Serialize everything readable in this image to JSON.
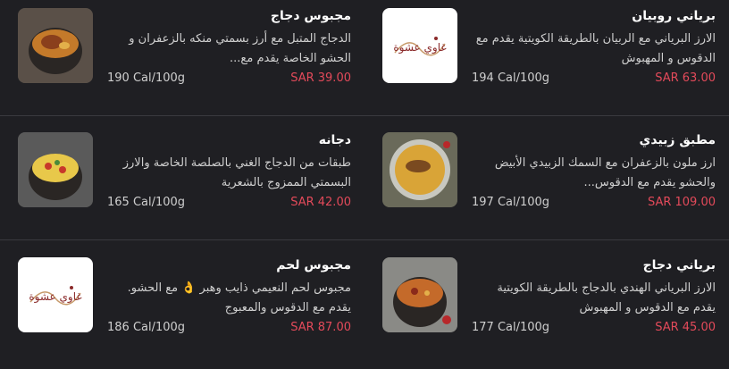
{
  "items": [
    {
      "title": "برياني روبيان",
      "desc": "الارز البرياني مع الربيان بالطريقة الكويتية يقدم مع الدقوس و المهبوش",
      "price": "SAR 63.00",
      "cal": "194 Cal/100g",
      "image": "logo",
      "logo_text": "غاوي عشوة"
    },
    {
      "title": "مجبوس دجاج",
      "desc": "الدجاج المتبل مع أرز بسمتي منكه بالزعفران و الحشو الخاصة يقدم مع...",
      "price": "SAR 39.00",
      "cal": "190 Cal/100g",
      "image": "photo"
    },
    {
      "title": "مطبق زبيدي",
      "desc": "ارز ملون بالزعفران مع السمك الزبيدي الأبيض والحشو يقدم مع الدقوس...",
      "price": "SAR 109.00",
      "cal": "197 Cal/100g",
      "image": "photo"
    },
    {
      "title": "دجانه",
      "desc": "طبقات من الدجاج الغني بالصلصة الخاصة والارز البسمتي الممزوج بالشعرية",
      "price": "SAR 42.00",
      "cal": "165 Cal/100g",
      "image": "photo"
    },
    {
      "title": "برياني دجاج",
      "desc": "الارز البرياني الهندي بالدجاج بالطريقة الكويتية يقدم مع الدقوس و المهبوش",
      "price": "SAR 45.00",
      "cal": "177 Cal/100g",
      "image": "photo"
    },
    {
      "title": "مجبوس لحم",
      "desc": "مجبوس لحم النعيمي ذايب وهبر 👌 مع الحشو. يقدم مع الدقوس والمعبوج",
      "price": "SAR 87.00",
      "cal": "186 Cal/100g",
      "image": "logo",
      "logo_text": "غاوي عشوة"
    }
  ],
  "colors": {
    "price": "#e34a5a",
    "background": "#1f1f23"
  }
}
